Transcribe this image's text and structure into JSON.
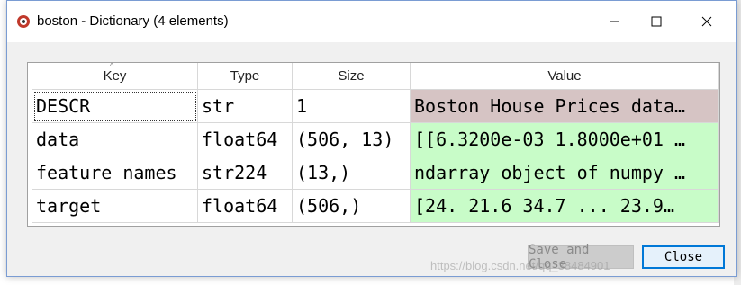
{
  "window": {
    "title": "boston - Dictionary (4 elements)"
  },
  "table": {
    "headers": {
      "key": "Key",
      "type": "Type",
      "size": "Size",
      "value": "Value"
    },
    "rows": [
      {
        "key": "DESCR",
        "type": "str",
        "size": "1",
        "value": "Boston House Prices data…",
        "color": "#d6c4c4"
      },
      {
        "key": "data",
        "type": "float64",
        "size": "(506, 13)",
        "value": "[[6.3200e-03 1.8000e+01 …",
        "color": "#c8fcc8"
      },
      {
        "key": "feature_names",
        "type": "str224",
        "size": "(13,)",
        "value": "ndarray object of numpy …",
        "color": "#c8fcc8"
      },
      {
        "key": "target",
        "type": "float64",
        "size": "(506,)",
        "value": "[24.  21.6 34.7 ... 23.9…",
        "color": "#c8fcc8"
      }
    ]
  },
  "buttons": {
    "save_close": "Save and Close",
    "close": "Close"
  },
  "watermark": "https://blog.csdn.net/qq_38484901",
  "colors": {
    "accent": "#0078d7",
    "descr_row_bg": "#d6c4c4",
    "array_row_bg": "#c8fcc8"
  }
}
